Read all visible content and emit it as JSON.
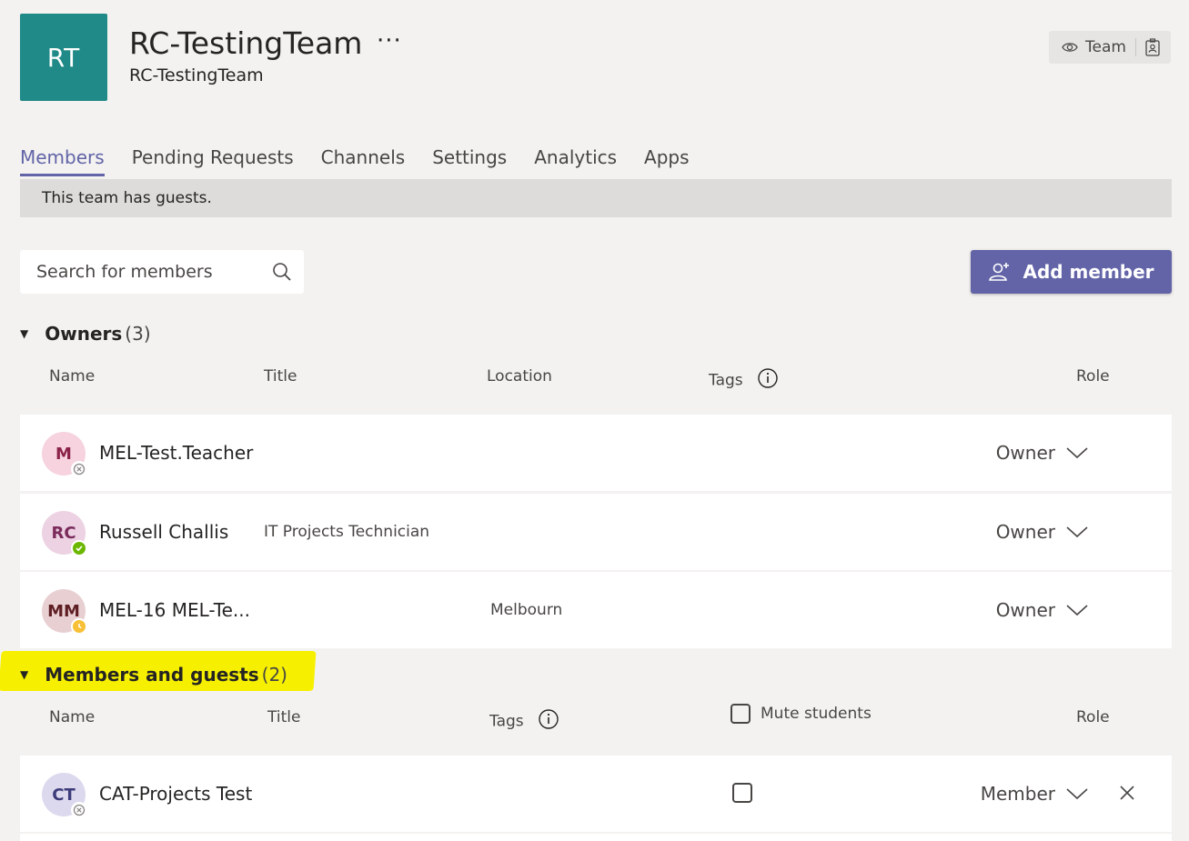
{
  "header": {
    "avatar_initials": "RT",
    "avatar_color": "#1f8a87",
    "team_name": "RC-TestingTeam",
    "more_label": "···",
    "team_description": "RC-TestingTeam",
    "badge_label": "Team"
  },
  "tabs": [
    {
      "label": "Members",
      "active": true
    },
    {
      "label": "Pending Requests"
    },
    {
      "label": "Channels"
    },
    {
      "label": "Settings"
    },
    {
      "label": "Analytics"
    },
    {
      "label": "Apps"
    }
  ],
  "banner": {
    "text": "This team has guests."
  },
  "search": {
    "placeholder": "Search for members"
  },
  "add_member": {
    "label": "Add member"
  },
  "owners": {
    "title": "Owners",
    "count": "(3)",
    "columns": {
      "name": "Name",
      "title": "Title",
      "location": "Location",
      "tags": "Tags",
      "role": "Role"
    },
    "rows": [
      {
        "initials": "M",
        "name": "MEL-Test.Teacher",
        "title": "",
        "location": "",
        "role": "Owner",
        "avatar_bg": "#f6d3de",
        "avatar_fg": "#8b2249",
        "status": "offline"
      },
      {
        "initials": "RC",
        "name": "Russell Challis",
        "title": "IT Projects Technician",
        "location": "",
        "role": "Owner",
        "avatar_bg": "#ecd2e2",
        "avatar_fg": "#7a2b5b",
        "status": "available"
      },
      {
        "initials": "MM",
        "name": "MEL-16 MEL-Te...",
        "title": "",
        "location": "Melbourn",
        "role": "Owner",
        "avatar_bg": "#e8d0d2",
        "avatar_fg": "#5e1e23",
        "status": "away"
      }
    ]
  },
  "members": {
    "title": "Members and guests",
    "count": "(2)",
    "columns": {
      "name": "Name",
      "title": "Title",
      "tags": "Tags",
      "mute": "Mute students",
      "role": "Role"
    },
    "rows": [
      {
        "initials": "CT",
        "name": "CAT-Projects Test",
        "role": "Member",
        "avatar_bg": "#dcd9ee",
        "avatar_fg": "#3d3b7a",
        "status": "offline"
      }
    ]
  },
  "colors": {
    "accent": "#6264a7",
    "highlight": "#f6f000"
  }
}
